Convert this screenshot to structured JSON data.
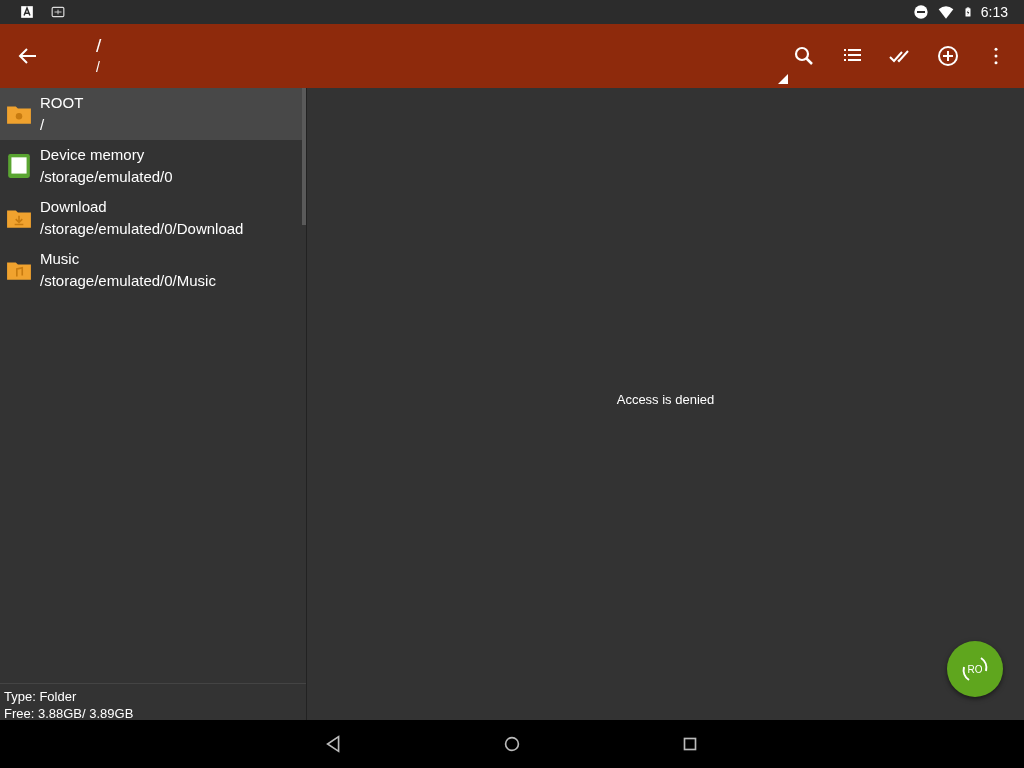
{
  "status_bar": {
    "time": "6:13"
  },
  "toolbar": {
    "title": "/",
    "subtitle": "/"
  },
  "locations": [
    {
      "name": "ROOT",
      "path": "/",
      "kind": "root",
      "selected": true
    },
    {
      "name": "Device memory",
      "path": "/storage/emulated/0",
      "kind": "storage",
      "selected": false
    },
    {
      "name": "Download",
      "path": "/storage/emulated/0/Download",
      "kind": "download",
      "selected": false
    },
    {
      "name": "Music",
      "path": "/storage/emulated/0/Music",
      "kind": "music",
      "selected": false
    }
  ],
  "details": {
    "type": "Type: Folder",
    "free": "Free: 3.88GB/ 3.89GB"
  },
  "main": {
    "message": "Access is denied"
  },
  "fab": {
    "label": "RO"
  }
}
